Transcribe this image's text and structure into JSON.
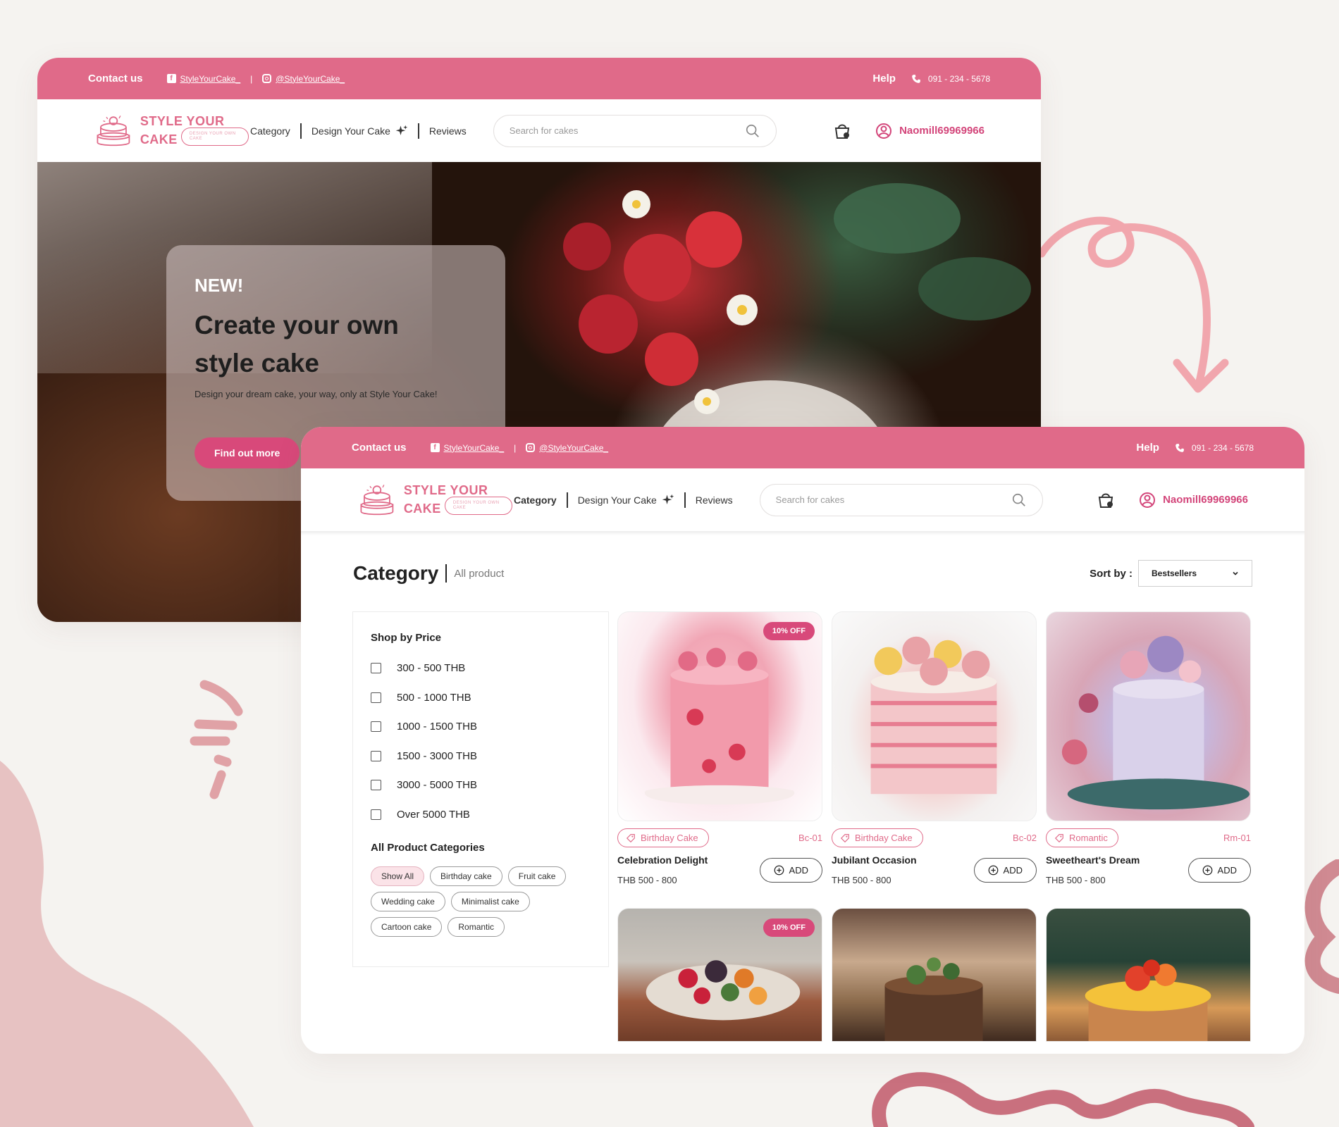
{
  "colors": {
    "brand_pink": "#e06a89",
    "accent_pink": "#d8497a",
    "background": "#f5f3f0"
  },
  "topbar": {
    "contact": "Contact us",
    "facebook": "StyleYourCake_",
    "separator": "|",
    "instagram": "@StyleYourCake_",
    "help": "Help",
    "phone": "091 - 234 - 5678"
  },
  "navbar": {
    "logo_line1": "STYLE YOUR",
    "logo_line2": "CAKE",
    "logo_tagline": "DESIGN YOUR OWN CAKE",
    "menu": [
      "Category",
      "Design Your Cake",
      "Reviews"
    ],
    "search_placeholder": "Search for cakes",
    "username": "Naomill69969966"
  },
  "hero": {
    "eyebrow": "NEW!",
    "headline": "Create your own style cake",
    "subtitle": "Design your dream cake, your way, only at Style Your Cake!",
    "cta": "Find out more"
  },
  "category_page": {
    "title": "Category",
    "subtitle": "All product",
    "sort_label": "Sort by :",
    "sort_value": "Bestsellers",
    "price_filter_title": "Shop by Price",
    "price_ranges": [
      "300 - 500 THB",
      "500 - 1000 THB",
      "1000 - 1500 THB",
      "1500 - 3000 THB",
      "3000 - 5000 THB",
      "Over 5000 THB"
    ],
    "categories_title": "All Product Categories",
    "categories": [
      "Show All",
      "Birthday cake",
      "Fruit cake",
      "Wedding cake",
      "Minimalist cake",
      "Cartoon cake",
      "Romantic"
    ],
    "products": [
      {
        "badge": "10% OFF",
        "tag": "Birthday Cake",
        "code": "Bc-01",
        "name": "Celebration Delight",
        "price": "THB 500 - 800",
        "add": "ADD"
      },
      {
        "badge": "",
        "tag": "Birthday Cake",
        "code": "Bc-02",
        "name": "Jubilant Occasion",
        "price": "THB 500 - 800",
        "add": "ADD"
      },
      {
        "badge": "",
        "tag": "Romantic",
        "code": "Rm-01",
        "name": "Sweetheart's Dream",
        "price": "THB 500 - 800",
        "add": "ADD"
      },
      {
        "badge": "10% OFF"
      },
      {
        "badge": ""
      },
      {
        "badge": ""
      }
    ]
  }
}
